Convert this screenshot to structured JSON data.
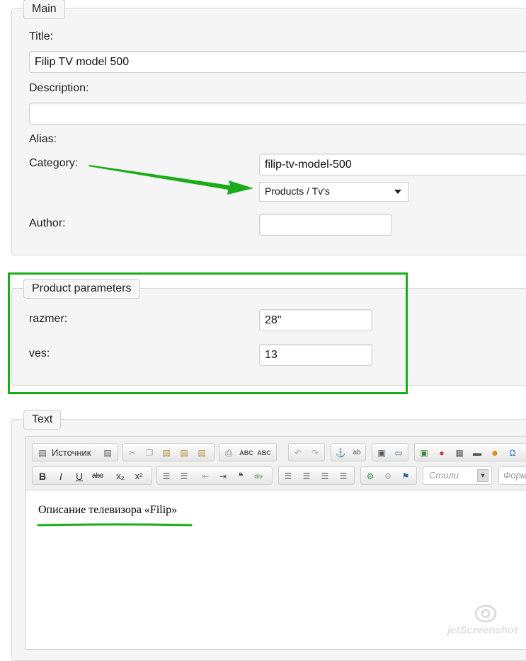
{
  "main": {
    "legend": "Main",
    "title_label": "Title:",
    "title_value": "Filip TV model 500",
    "description_label": "Description:",
    "description_value": "",
    "alias_label": "Alias:",
    "alias_value": "filip-tv-model-500",
    "category_label": "Category:",
    "category_value": "Products / Tv's",
    "author_label": "Author:",
    "author_value": ""
  },
  "product_params": {
    "legend": "Product parameters",
    "razmer_label": "razmer:",
    "razmer_value": "28\"",
    "ves_label": "ves:",
    "ves_value": "13"
  },
  "text": {
    "legend": "Text",
    "source_label": "Источник",
    "styles_placeholder": "Стили",
    "format_placeholder": "Форм",
    "content": "Описание телевизора «Filip»"
  },
  "watermark": "jetScreenshot",
  "colors": {
    "annotation_green": "#1aad19"
  }
}
